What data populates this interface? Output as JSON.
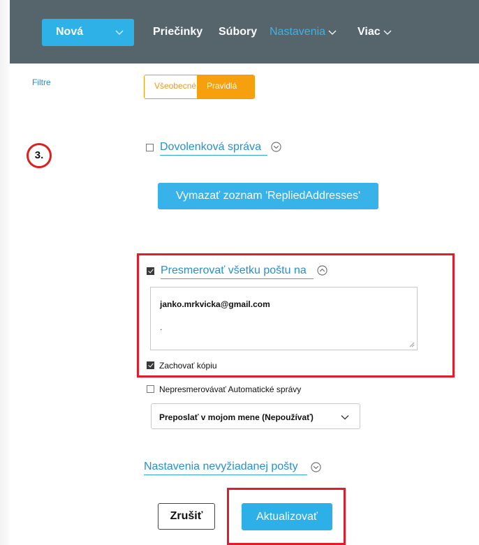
{
  "header": {
    "new_button_label": "Nová",
    "nav": {
      "folders": "Priečinky",
      "files": "Súbory",
      "settings": "Nastavenia",
      "more": "Viac"
    }
  },
  "sidebar": {
    "filters_link": "Filtre"
  },
  "tabs": {
    "general": "Všeobecné",
    "rules": "Pravidlá",
    "active": "Pravidlá"
  },
  "step_marker": "3.",
  "vacation": {
    "label": "Dovolenková správa",
    "checked": false
  },
  "clear_button_label": "Vymazať zoznam 'RepliedAddresses'",
  "forward": {
    "label": "Presmerovať všetku poštu na",
    "checked": true,
    "address": "janko.mrkvicka@gmail.com",
    "second_line": ".",
    "keep_copy_label": "Zachovať kópiu",
    "keep_copy_checked": true
  },
  "no_auto_forward": {
    "label": "Nepresmerovávať Automatické správy",
    "checked": false
  },
  "send_as_select": {
    "value": "Preposlať v mojom mene (Nepoužívať)"
  },
  "junk_settings_label": "Nastavenia nevyžiadanej pošty",
  "buttons": {
    "cancel": "Zrušiť",
    "update": "Aktualizovať"
  },
  "colors": {
    "accent": "#2eb1e6",
    "orange": "#f5a00c",
    "highlight_red": "#e21c2a",
    "header_bg": "#56646c"
  }
}
